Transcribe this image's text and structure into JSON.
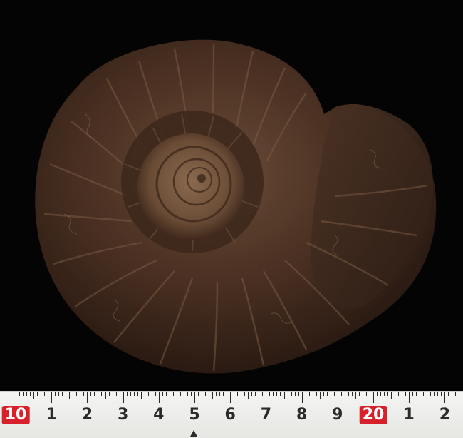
{
  "photo": {
    "subject": "ammonite fossil",
    "background_color": "#040405",
    "shell_colors": [
      "#3a2418",
      "#5a3a26",
      "#7a5a42"
    ]
  },
  "ruler": {
    "labels": [
      "10",
      "1",
      "2",
      "3",
      "4",
      "5",
      "6",
      "7",
      "8",
      "9",
      "20",
      "1",
      "2"
    ],
    "highlighted_labels": [
      "10",
      "20"
    ],
    "highlight_color": "#d8202a"
  }
}
